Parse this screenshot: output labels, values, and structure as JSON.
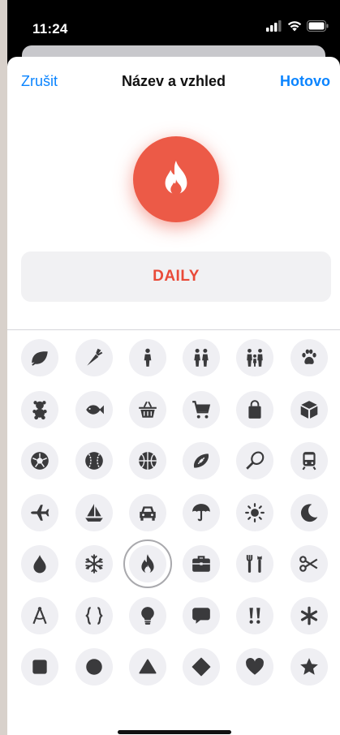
{
  "status_bar": {
    "time": "11:24"
  },
  "nav": {
    "cancel": "Zrušit",
    "title": "Název a vzhled",
    "done": "Hotovo"
  },
  "selected_icon": {
    "name": "flame-icon",
    "color": "#ec5a47"
  },
  "name_field": {
    "value": "DAILY",
    "color": "#e94a38"
  },
  "icons": [
    "leaf-icon",
    "carrot-icon",
    "person-icon",
    "two-people-icon",
    "family-icon",
    "paw-icon",
    "teddy-bear-icon",
    "fish-icon",
    "basket-icon",
    "cart-icon",
    "shopping-bag-icon",
    "box-icon",
    "soccer-ball-icon",
    "baseball-icon",
    "basketball-icon",
    "football-icon",
    "tennis-racket-icon",
    "train-icon",
    "airplane-icon",
    "sailboat-icon",
    "car-icon",
    "umbrella-icon",
    "sun-icon",
    "moon-icon",
    "drop-icon",
    "snowflake-icon",
    "flame-icon",
    "briefcase-icon",
    "tools-icon",
    "scissors-icon",
    "compass-icon",
    "braces-icon",
    "lightbulb-icon",
    "speech-bubble-icon",
    "exclamation-icon",
    "asterisk-icon",
    "square-icon",
    "circle-icon",
    "triangle-icon",
    "diamond-icon",
    "heart-icon",
    "star-icon"
  ],
  "selected_index": 26
}
